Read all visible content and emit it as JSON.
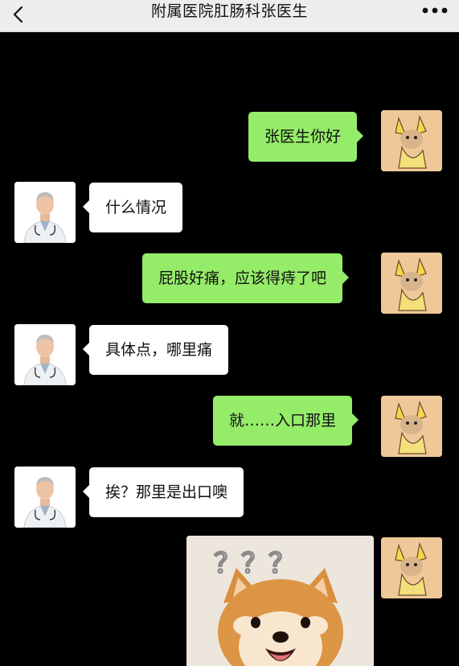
{
  "header": {
    "title": "附属医院肛肠科张医生",
    "back_icon": "chevron-left-icon",
    "more_icon": "more-dots-icon"
  },
  "messages": [
    {
      "sender": "user",
      "text": "张医生你好"
    },
    {
      "sender": "doctor",
      "text": "什么情况"
    },
    {
      "sender": "user",
      "text": "屁股好痛，应该得痔了吧"
    },
    {
      "sender": "doctor",
      "text": "具体点，哪里痛"
    },
    {
      "sender": "user",
      "text": "就……入口那里"
    },
    {
      "sender": "doctor",
      "text": "挨？那里是出口噢"
    },
    {
      "sender": "user",
      "type": "sticker",
      "sticker": "confused-shiba-dog-sticker",
      "sticker_text": "？？？"
    }
  ],
  "colors": {
    "chat_background": "#000000",
    "header_background": "#ededed",
    "sent_bubble": "#95ec69",
    "received_bubble": "#ffffff"
  }
}
